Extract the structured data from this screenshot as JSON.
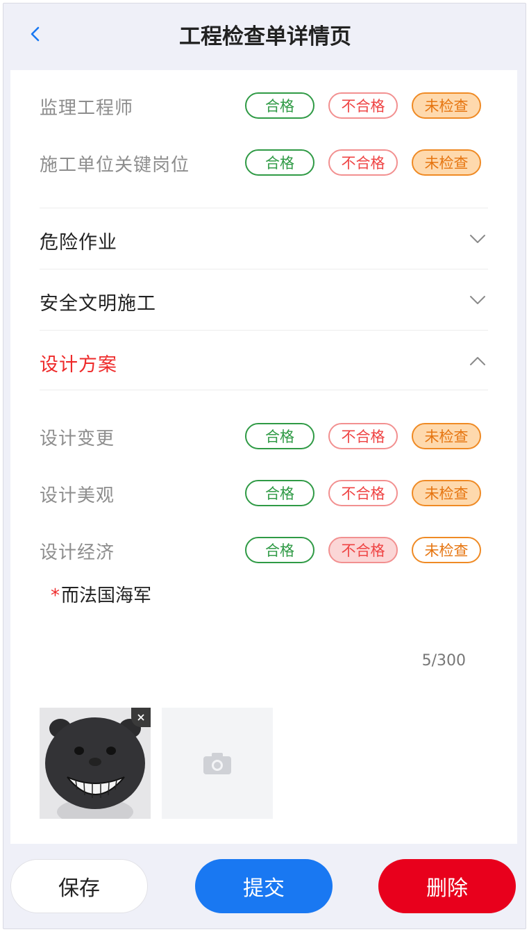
{
  "header": {
    "title": "工程检查单详情页"
  },
  "status_options": {
    "pass": "合格",
    "fail": "不合格",
    "unchecked": "未检查"
  },
  "group_top": {
    "items": [
      {
        "label": "监理工程师",
        "selected": "unchecked"
      },
      {
        "label": "施工单位关键岗位",
        "selected": "unchecked"
      }
    ]
  },
  "sections": [
    {
      "label": "危险作业",
      "expanded": false
    },
    {
      "label": "安全文明施工",
      "expanded": false
    },
    {
      "label": "设计方案",
      "expanded": true
    }
  ],
  "design_items": [
    {
      "label": "设计变更",
      "selected": "unchecked"
    },
    {
      "label": "设计美观",
      "selected": "unchecked"
    },
    {
      "label": "设计经济",
      "selected": "fail"
    }
  ],
  "remark": {
    "required_mark": "*",
    "text": "而法国海军",
    "counter": "5/300"
  },
  "footer": {
    "save": "保存",
    "submit": "提交",
    "delete": "删除"
  },
  "colors": {
    "accent": "#1978f2",
    "danger": "#e8001c",
    "pass": "#2f9a45",
    "unchecked": "#ef8a24",
    "active_section": "#ee2a2a"
  },
  "icons": {
    "back": "chevron-left-icon",
    "collapsed": "chevron-down-icon",
    "expanded": "chevron-up-icon",
    "upload": "camera-icon",
    "remove": "close-icon"
  }
}
